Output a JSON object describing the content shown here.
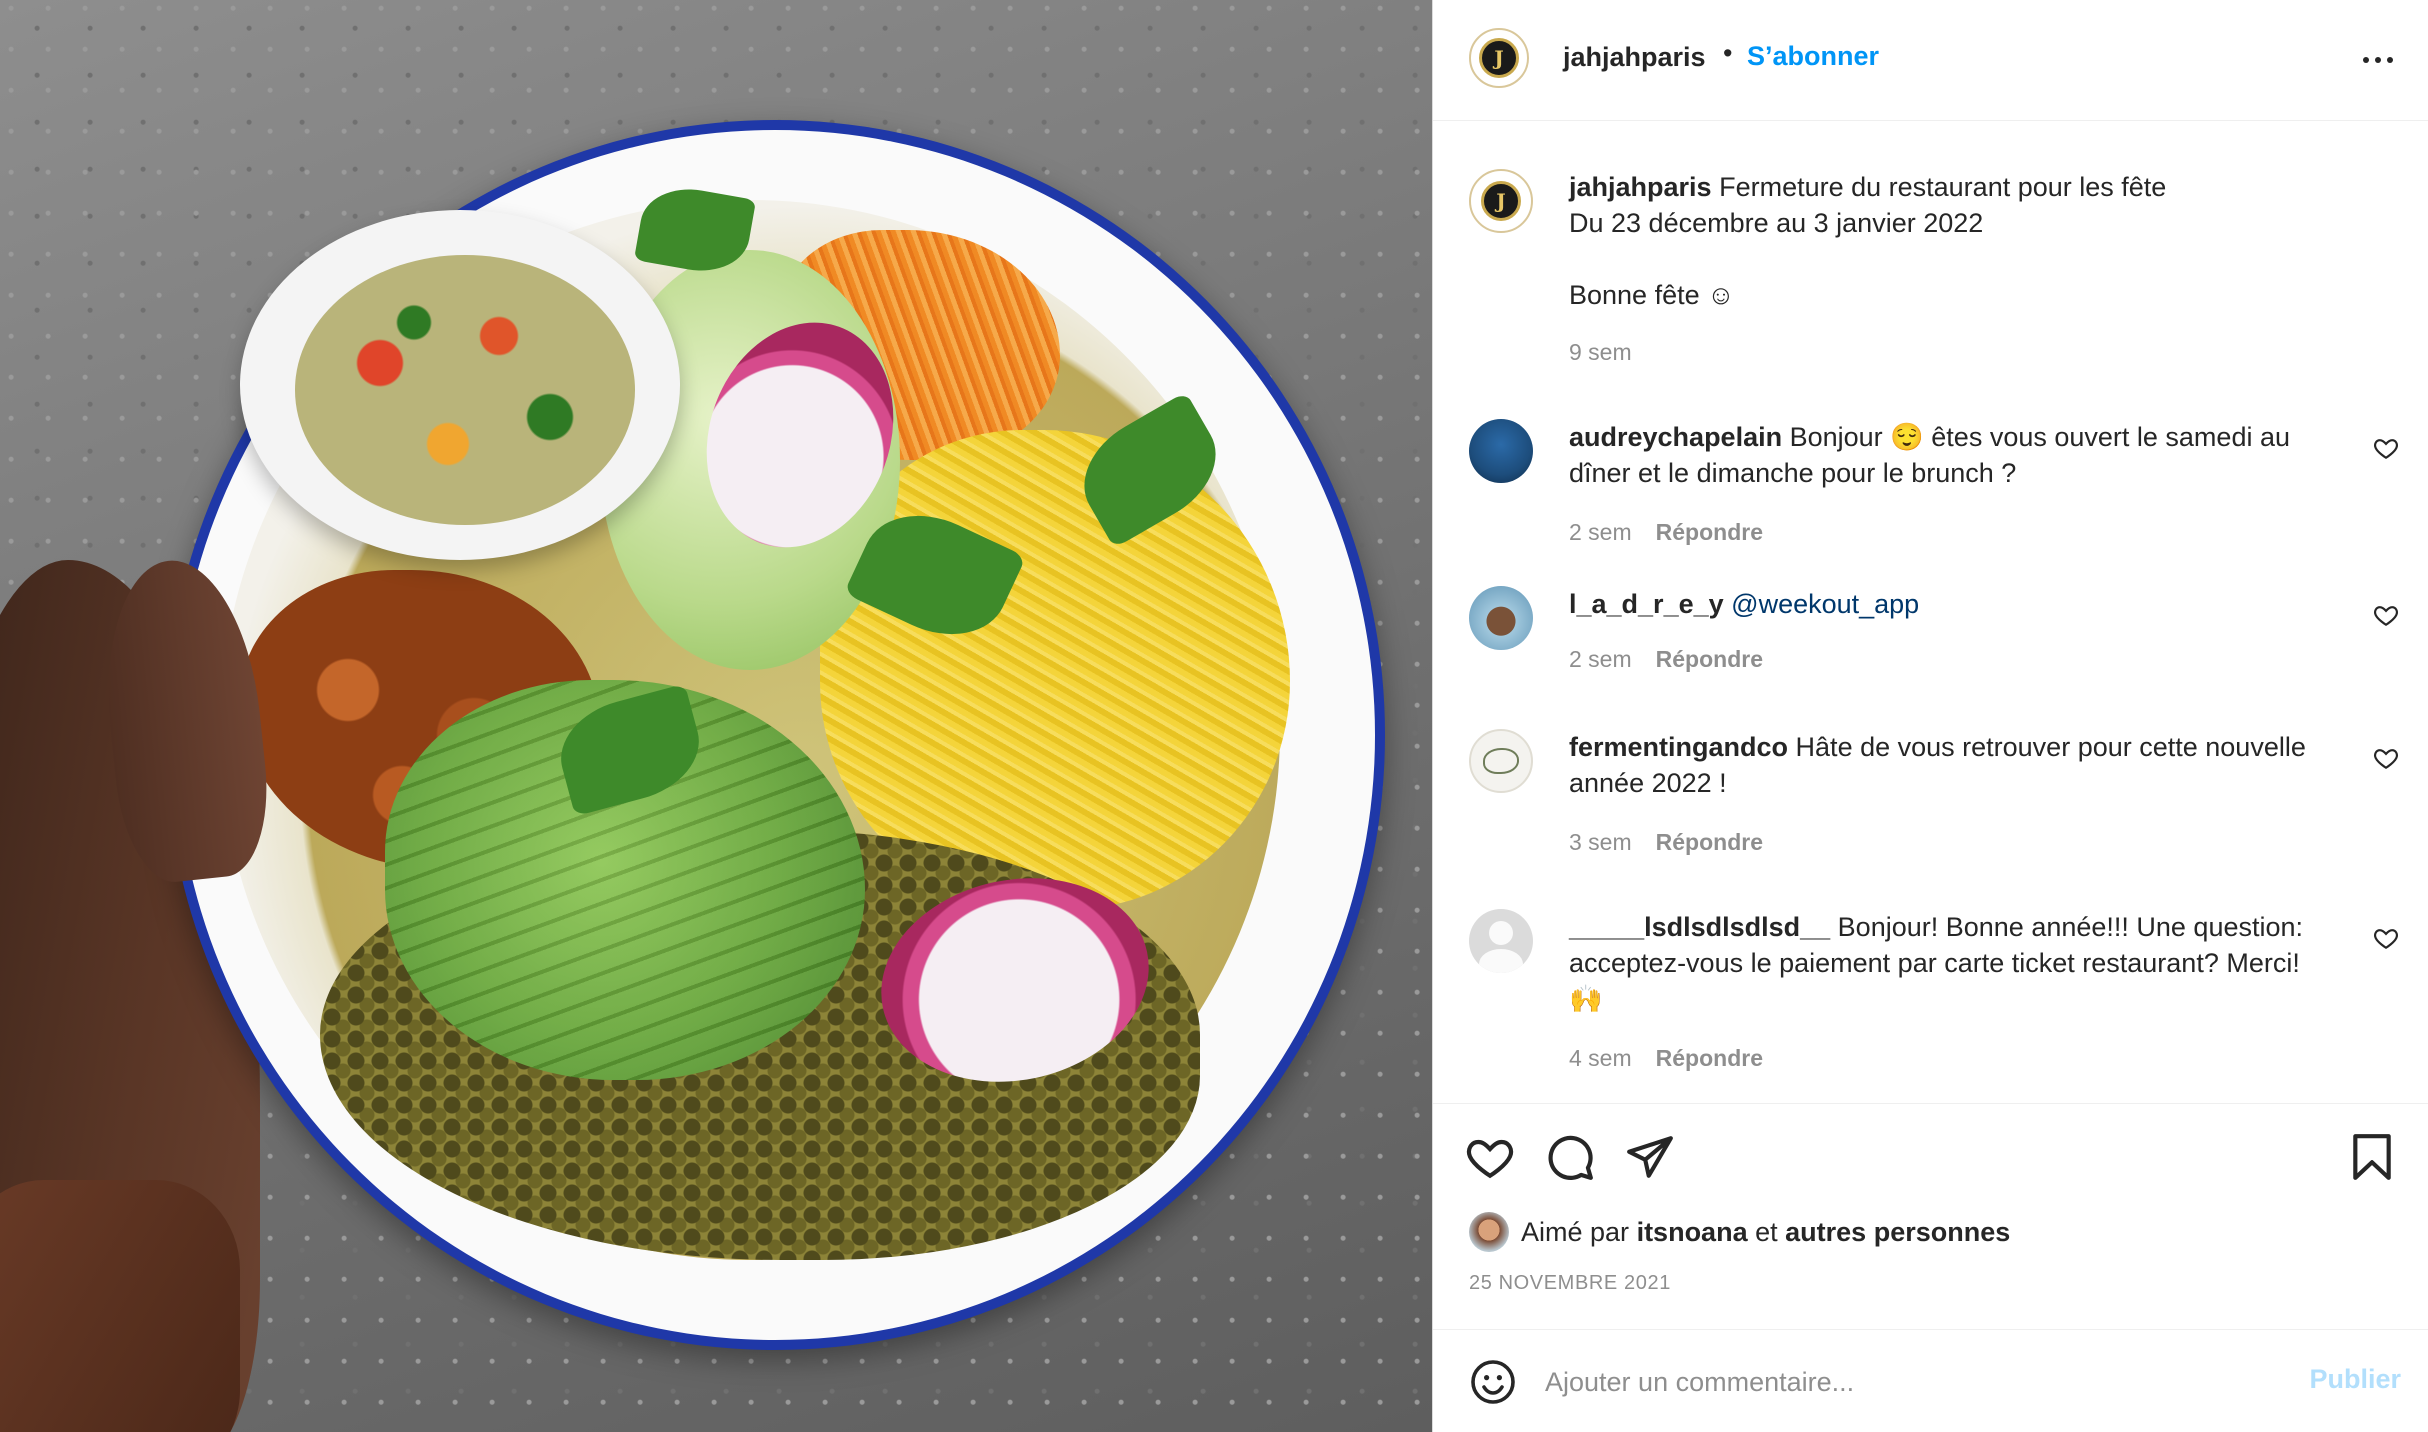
{
  "post": {
    "username": "jahjahparis",
    "avatar_letter": "J",
    "follow_label": "S’abonner",
    "caption_line1": "Fermeture du restaurant pour les fête",
    "caption_line2": "Du 23 décembre au 3 janvier 2022",
    "caption_line3": "Bonne fête ☺",
    "caption_time": "9 sem"
  },
  "comments": [
    {
      "username": "audreychapelain",
      "text": "Bonjour 😌 êtes vous ouvert le samedi au dîner et le dimanche pour le brunch ?",
      "time": "2 sem",
      "reply_label": "Répondre"
    },
    {
      "username": "l_a_d_r_e_y",
      "mention": "@weekout_app",
      "time": "2 sem",
      "reply_label": "Répondre"
    },
    {
      "username": "fermentingandco",
      "text": "Hâte de vous retrouver pour cette nouvelle année 2022 !",
      "time": "3 sem",
      "reply_label": "Répondre"
    },
    {
      "username": "_____lsdlsdlsdlsd__",
      "text": "Bonjour! Bonne année!!! Une question: acceptez-vous le paiement par carte ticket restaurant? Merci! 🙌",
      "time": "4 sem",
      "reply_label": "Répondre"
    }
  ],
  "likes": {
    "prefix": "Aimé par",
    "user": "itsnoana",
    "joiner": "et",
    "others": "autres personnes"
  },
  "date": "25 NOVEMBRE 2021",
  "composer": {
    "placeholder": "Ajouter un commentaire...",
    "publish_label": "Publier"
  },
  "colors": {
    "accent": "#0095f6",
    "publish_disabled": "#b2dffc",
    "secondary_text": "#8e8e8e",
    "mention": "#00376b",
    "plate_rim": "#1f38a8"
  },
  "icons": {
    "header": "more-horizontal-icon",
    "comment_like": "heart-icon",
    "actions": [
      "heart-icon",
      "comment-icon",
      "share-icon",
      "bookmark-icon"
    ],
    "composer": "emoji-icon"
  }
}
